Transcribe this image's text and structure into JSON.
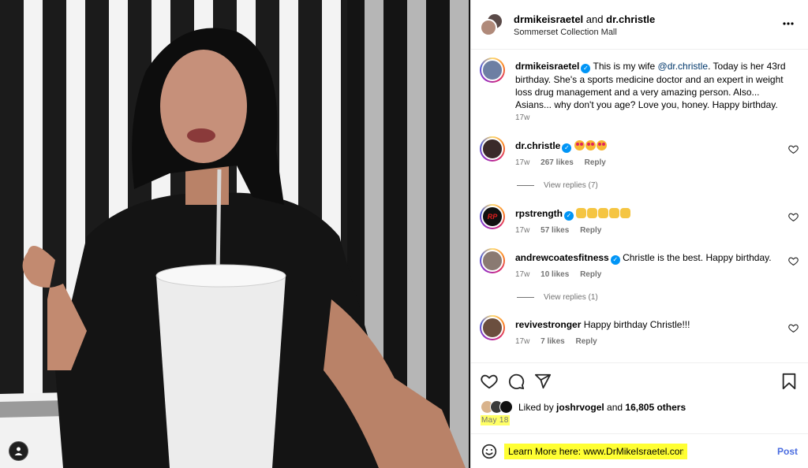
{
  "header": {
    "user1": "drmikeisraetel",
    "joiner": "and",
    "user2": "dr.christle",
    "location": "Sommerset Collection Mall"
  },
  "caption": {
    "username": "drmikeisraetel",
    "text_before": "This is my wife ",
    "mention": "@dr.christle",
    "text_after": ". Today is her 43rd birthday. She's a sports medicine doctor and an expert in weight loss drug management and a very amazing person. Also... Asians... why don't you age? Love you, honey. Happy birthday.",
    "time": "17w"
  },
  "comments": [
    {
      "username": "dr.christle",
      "verified": true,
      "text": "",
      "emoji": "heart-eyes",
      "emoji_count": 3,
      "time": "17w",
      "likes": "267 likes",
      "reply": "Reply",
      "view_replies": "View replies (7)"
    },
    {
      "username": "rpstrength",
      "verified": true,
      "text": "",
      "emoji": "clap",
      "emoji_count": 5,
      "time": "17w",
      "likes": "57 likes",
      "reply": "Reply",
      "view_replies": ""
    },
    {
      "username": "andrewcoatesfitness",
      "verified": true,
      "text": "Christle is the best. Happy birthday.",
      "time": "17w",
      "likes": "10 likes",
      "reply": "Reply",
      "view_replies": "View replies (1)"
    },
    {
      "username": "revivestronger",
      "verified": false,
      "text": "Happy birthday Christle!!!",
      "time": "17w",
      "likes": "7 likes",
      "reply": "Reply",
      "view_replies": ""
    }
  ],
  "likes": {
    "prefix": "Liked by ",
    "user": "joshrvogel",
    "middle": " and ",
    "others": "16,805 others"
  },
  "date": "May 18",
  "composer": {
    "value": "Learn More here: www.DrMikeIsraetel.com",
    "post_label": "Post"
  },
  "icons": {
    "more": "more-horizontal-icon",
    "like": "heart-icon",
    "comment": "comment-bubble-icon",
    "share": "paper-plane-icon",
    "save": "bookmark-icon",
    "emoji": "smiley-icon",
    "tag": "user-tag-icon"
  },
  "colors": {
    "accent": "#0095f6",
    "post_button": "#4a6ce0",
    "highlight": "#ffff33",
    "muted": "#737373"
  }
}
